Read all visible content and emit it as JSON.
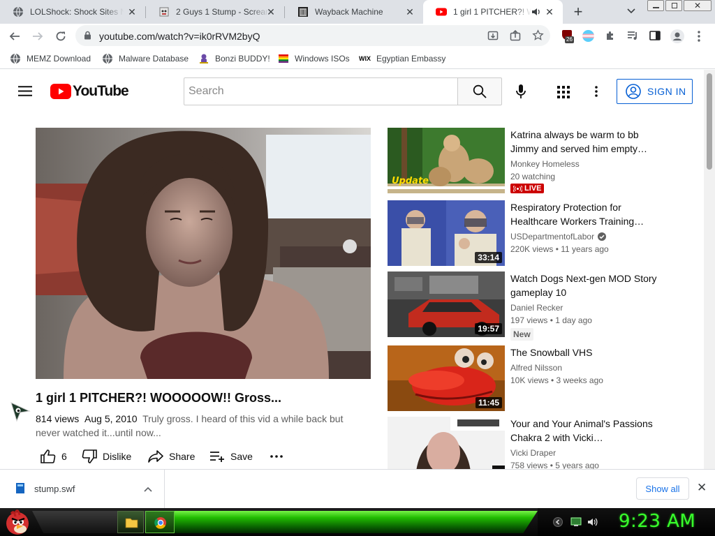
{
  "browser": {
    "tabs": [
      {
        "title": "LOLShock: Shock Sites Ne",
        "favicon": "globe-icon",
        "active": false
      },
      {
        "title": "2 Guys 1 Stump - Scream",
        "favicon": "ghost-icon",
        "active": false
      },
      {
        "title": "Wayback Machine",
        "favicon": "archive-icon",
        "active": false
      },
      {
        "title": "1 girl 1 PITCHER?! WO",
        "favicon": "youtube-icon",
        "active": true
      }
    ],
    "url": "youtube.com/watch?v=ik0rRVM2byQ",
    "extension_badge": "26",
    "bookmarks": [
      {
        "label": "MEMZ Download",
        "icon": "globe-icon"
      },
      {
        "label": "Malware Database",
        "icon": "globe-icon"
      },
      {
        "label": "Bonzi BUDDY!",
        "icon": "bonzi-icon"
      },
      {
        "label": "Windows ISOs",
        "icon": "windows-flag-icon"
      },
      {
        "label": "Egyptian Embassy",
        "icon": "wix-icon"
      }
    ]
  },
  "youtube": {
    "logo_text": "YouTube",
    "search_placeholder": "Search",
    "sign_in": "SIGN IN",
    "video": {
      "title": "1 girl 1 PITCHER?! WOOOOOW!! Gross...",
      "views": "814 views",
      "date": "Aug 5, 2010",
      "description": "Truly gross. I heard of this vid a while back but never watched it...until now...",
      "likes": "6",
      "dislike_label": "Dislike",
      "share_label": "Share",
      "save_label": "Save"
    },
    "recommendations": [
      {
        "title": "Katrina always be warm to bb Jimmy and served him empty…",
        "channel": "Monkey Homeless",
        "stats": "20 watching",
        "badge": "LIVE",
        "duration": "",
        "thumb_caption": "Update"
      },
      {
        "title": "Respiratory Protection for Healthcare Workers Training…",
        "channel": "USDepartmentofLabor",
        "verified": true,
        "stats": "220K views • 11 years ago",
        "duration": "33:14"
      },
      {
        "title": "Watch Dogs Next-gen MOD Story gameplay 10",
        "channel": "Daniel Recker",
        "stats": "197 views • 1 day ago",
        "badge": "New",
        "duration": "19:57"
      },
      {
        "title": "The Snowball VHS",
        "channel": "Alfred Nilsson",
        "stats": "10K views • 3 weeks ago",
        "duration": "11:45"
      },
      {
        "title": "Your and Your Animal's Passions Chakra 2 with Vicki…",
        "channel": "Vicki Draper",
        "stats": "758 views • 5 years ago",
        "duration": ""
      }
    ]
  },
  "downloads": {
    "file": "stump.swf",
    "show_all": "Show all"
  },
  "taskbar": {
    "clock": "9:23 AM"
  },
  "colors": {
    "youtube_red": "#ff0000",
    "link_blue": "#065fd4",
    "live_red": "#cc0000",
    "taskbar_green": "#38ff2c"
  }
}
